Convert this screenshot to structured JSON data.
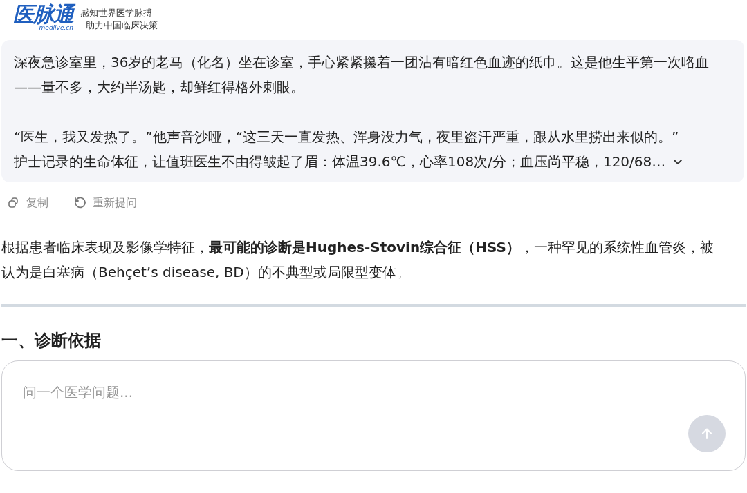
{
  "header": {
    "logo": "医脉通",
    "logo_domain": "medlive.cn",
    "slogan": [
      "感知世界医学脉搏",
      "助力中国临床决策"
    ]
  },
  "question": {
    "paragraphs": [
      "深夜急诊室里，36岁的老马（化名）坐在诊室，手心紧紧攥着一团沾有暗红色血迹的纸巾。这是他生平第一次咯血——量不多，大约半汤匙，却鲜红得格外刺眼。",
      "“医生，我又发热了。”他声音沙哑，“这三天一直发热、浑身没力气，夜里盗汗严重，跟从水里捞出来似的。”",
      "护士记录的生命体征，让值班医生不由得皱起了眉：体温39.6℃，心率108次/分；血压尚平稳，120/68…"
    ],
    "expanded": false
  },
  "actions": [
    {
      "kind": "copy",
      "label": "复制"
    },
    {
      "kind": "retry",
      "label": "重新提问"
    }
  ],
  "answer": {
    "paragraph": "根据患者临床表现及影像学特征，**最可能的诊断是Hughes-Stovin综合征（HSS）**，一种罕见的系统性血管炎，被认为是白塞病（Behçet’s disease, BD）的不典型或局限型变体。",
    "heading": "一、诊断依据"
  },
  "composer": {
    "placeholder": "问一个医学问题..."
  }
}
